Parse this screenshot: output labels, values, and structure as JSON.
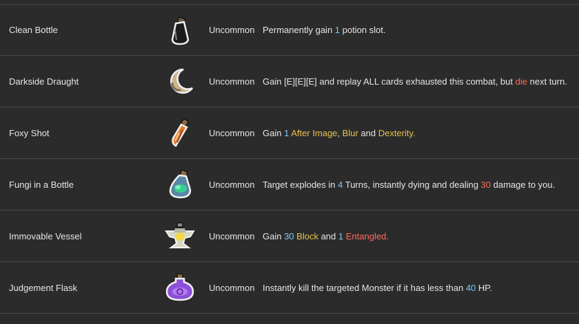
{
  "potions": [
    {
      "name": "Clean Bottle",
      "icon": "clean-bottle-icon",
      "rarity": "Uncommon",
      "desc": [
        {
          "t": "Permanently gain ",
          "c": ""
        },
        {
          "t": "1",
          "c": "blue"
        },
        {
          "t": " potion slot.",
          "c": ""
        }
      ]
    },
    {
      "name": "Darkside Draught",
      "icon": "crescent-moon-icon",
      "rarity": "Uncommon",
      "desc": [
        {
          "t": "Gain [E][E][E] and replay ALL cards exhausted this combat, but ",
          "c": ""
        },
        {
          "t": "die",
          "c": "red"
        },
        {
          "t": " next turn.",
          "c": ""
        }
      ]
    },
    {
      "name": "Foxy Shot",
      "icon": "orange-vial-icon",
      "rarity": "Uncommon",
      "desc": [
        {
          "t": "Gain ",
          "c": ""
        },
        {
          "t": "1",
          "c": "blue"
        },
        {
          "t": " ",
          "c": ""
        },
        {
          "t": "After Image",
          "c": "gold"
        },
        {
          "t": ", ",
          "c": ""
        },
        {
          "t": "Blur",
          "c": "gold"
        },
        {
          "t": " and ",
          "c": ""
        },
        {
          "t": "Dexterity.",
          "c": "gold"
        }
      ]
    },
    {
      "name": "Fungi in a Bottle",
      "icon": "fungi-bottle-icon",
      "rarity": "Uncommon",
      "desc": [
        {
          "t": "Target explodes in ",
          "c": ""
        },
        {
          "t": "4",
          "c": "blue"
        },
        {
          "t": " Turns, instantly dying and dealing ",
          "c": ""
        },
        {
          "t": "30",
          "c": "red"
        },
        {
          "t": " damage to you.",
          "c": ""
        }
      ]
    },
    {
      "name": "Immovable Vessel",
      "icon": "anvil-vessel-icon",
      "rarity": "Uncommon",
      "desc": [
        {
          "t": "Gain ",
          "c": ""
        },
        {
          "t": "30",
          "c": "blue"
        },
        {
          "t": " ",
          "c": ""
        },
        {
          "t": "Block",
          "c": "gold"
        },
        {
          "t": " and ",
          "c": ""
        },
        {
          "t": "1",
          "c": "blue"
        },
        {
          "t": " ",
          "c": ""
        },
        {
          "t": "Entangled.",
          "c": "red"
        }
      ]
    },
    {
      "name": "Judgement Flask",
      "icon": "purple-flask-icon",
      "rarity": "Uncommon",
      "desc": [
        {
          "t": "Instantly kill the targeted Monster if it has less than ",
          "c": ""
        },
        {
          "t": "40",
          "c": "blue"
        },
        {
          "t": " HP.",
          "c": ""
        }
      ]
    }
  ]
}
